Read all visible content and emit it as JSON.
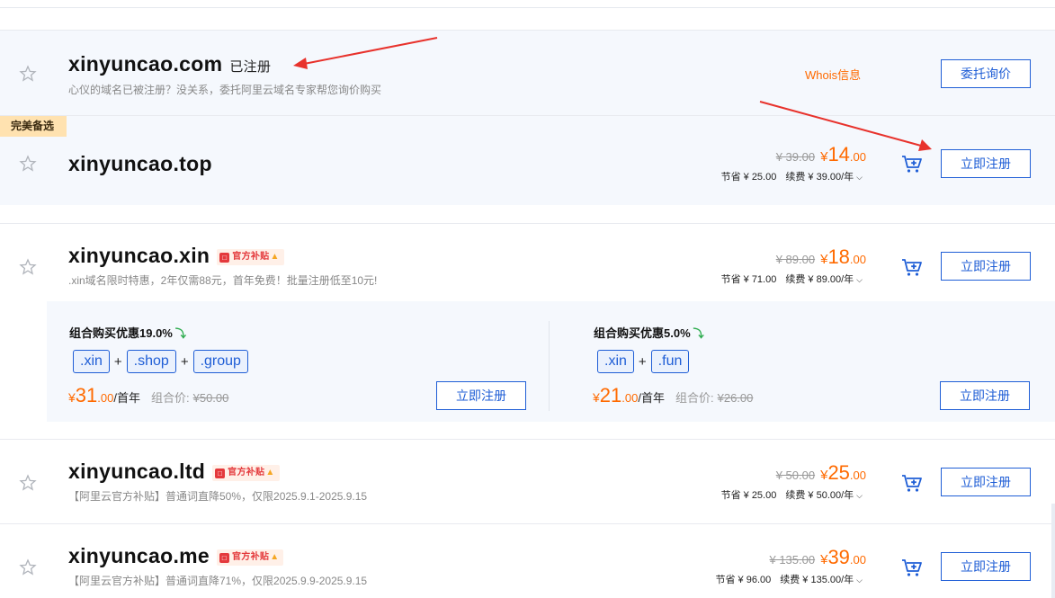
{
  "rows": [
    {
      "domain": "xinyuncao.com",
      "status": "已注册",
      "desc": "心仪的域名已被注册？没关系，委托阿里云域名专家帮您询价购买",
      "whois": "Whois信息",
      "button": "委托询价"
    },
    {
      "tag": "完美备选",
      "domain": "xinyuncao.top",
      "orig": "¥ 39.00",
      "yen": "¥",
      "int": "14",
      "cents": ".00",
      "save_label": "节省",
      "save": "¥ 25.00",
      "renew_label": "续费",
      "renew": "¥ 39.00/年",
      "button": "立即注册"
    },
    {
      "domain": "xinyuncao.xin",
      "badge": "官方补贴",
      "desc": ".xin域名限时特惠，2年仅需88元，首年免费！批量注册低至10元!",
      "orig": "¥ 89.00",
      "yen": "¥",
      "int": "18",
      "cents": ".00",
      "save_label": "节省",
      "save": "¥ 71.00",
      "renew_label": "续费",
      "renew": "¥ 89.00/年",
      "button": "立即注册"
    },
    {
      "domain": "xinyuncao.ltd",
      "badge": "官方补贴",
      "desc": "【阿里云官方补贴】普通词直降50%，仅限2025.9.1-2025.9.15",
      "orig": "¥ 50.00",
      "yen": "¥",
      "int": "25",
      "cents": ".00",
      "save_label": "节省",
      "save": "¥ 25.00",
      "renew_label": "续费",
      "renew": "¥ 50.00/年",
      "button": "立即注册"
    },
    {
      "domain": "xinyuncao.me",
      "badge": "官方补贴",
      "desc": "【阿里云官方补贴】普通词直降71%，仅限2025.9.9-2025.9.15",
      "orig": "¥ 135.00",
      "yen": "¥",
      "int": "39",
      "cents": ".00",
      "save_label": "节省",
      "save": "¥ 96.00",
      "renew_label": "续费",
      "renew": "¥ 135.00/年",
      "button": "立即注册"
    }
  ],
  "bundles": [
    {
      "title": "组合购买优惠19.0%",
      "tlds": [
        ".xin",
        ".shop",
        ".group"
      ],
      "plus": "+",
      "yen": "¥",
      "int": "31",
      "cents": ".00",
      "unit": "/首年",
      "combo_label": "组合价:",
      "combo_price": "¥50.00",
      "button": "立即注册"
    },
    {
      "title": "组合购买优惠5.0%",
      "tlds": [
        ".xin",
        ".fun"
      ],
      "plus": "+",
      "yen": "¥",
      "int": "21",
      "cents": ".00",
      "unit": "/首年",
      "combo_label": "组合价:",
      "combo_price": "¥26.00",
      "button": "立即注册"
    }
  ],
  "icons": {
    "star": "star-icon",
    "cart": "cart-add-icon",
    "chevron": "chevron-down-icon",
    "down": "down-arrow-icon"
  },
  "colors": {
    "accent_blue": "#1f5ed6",
    "price_orange": "#ff6a00",
    "badge_red": "#e4393c",
    "annotation_red": "#e8322c"
  }
}
